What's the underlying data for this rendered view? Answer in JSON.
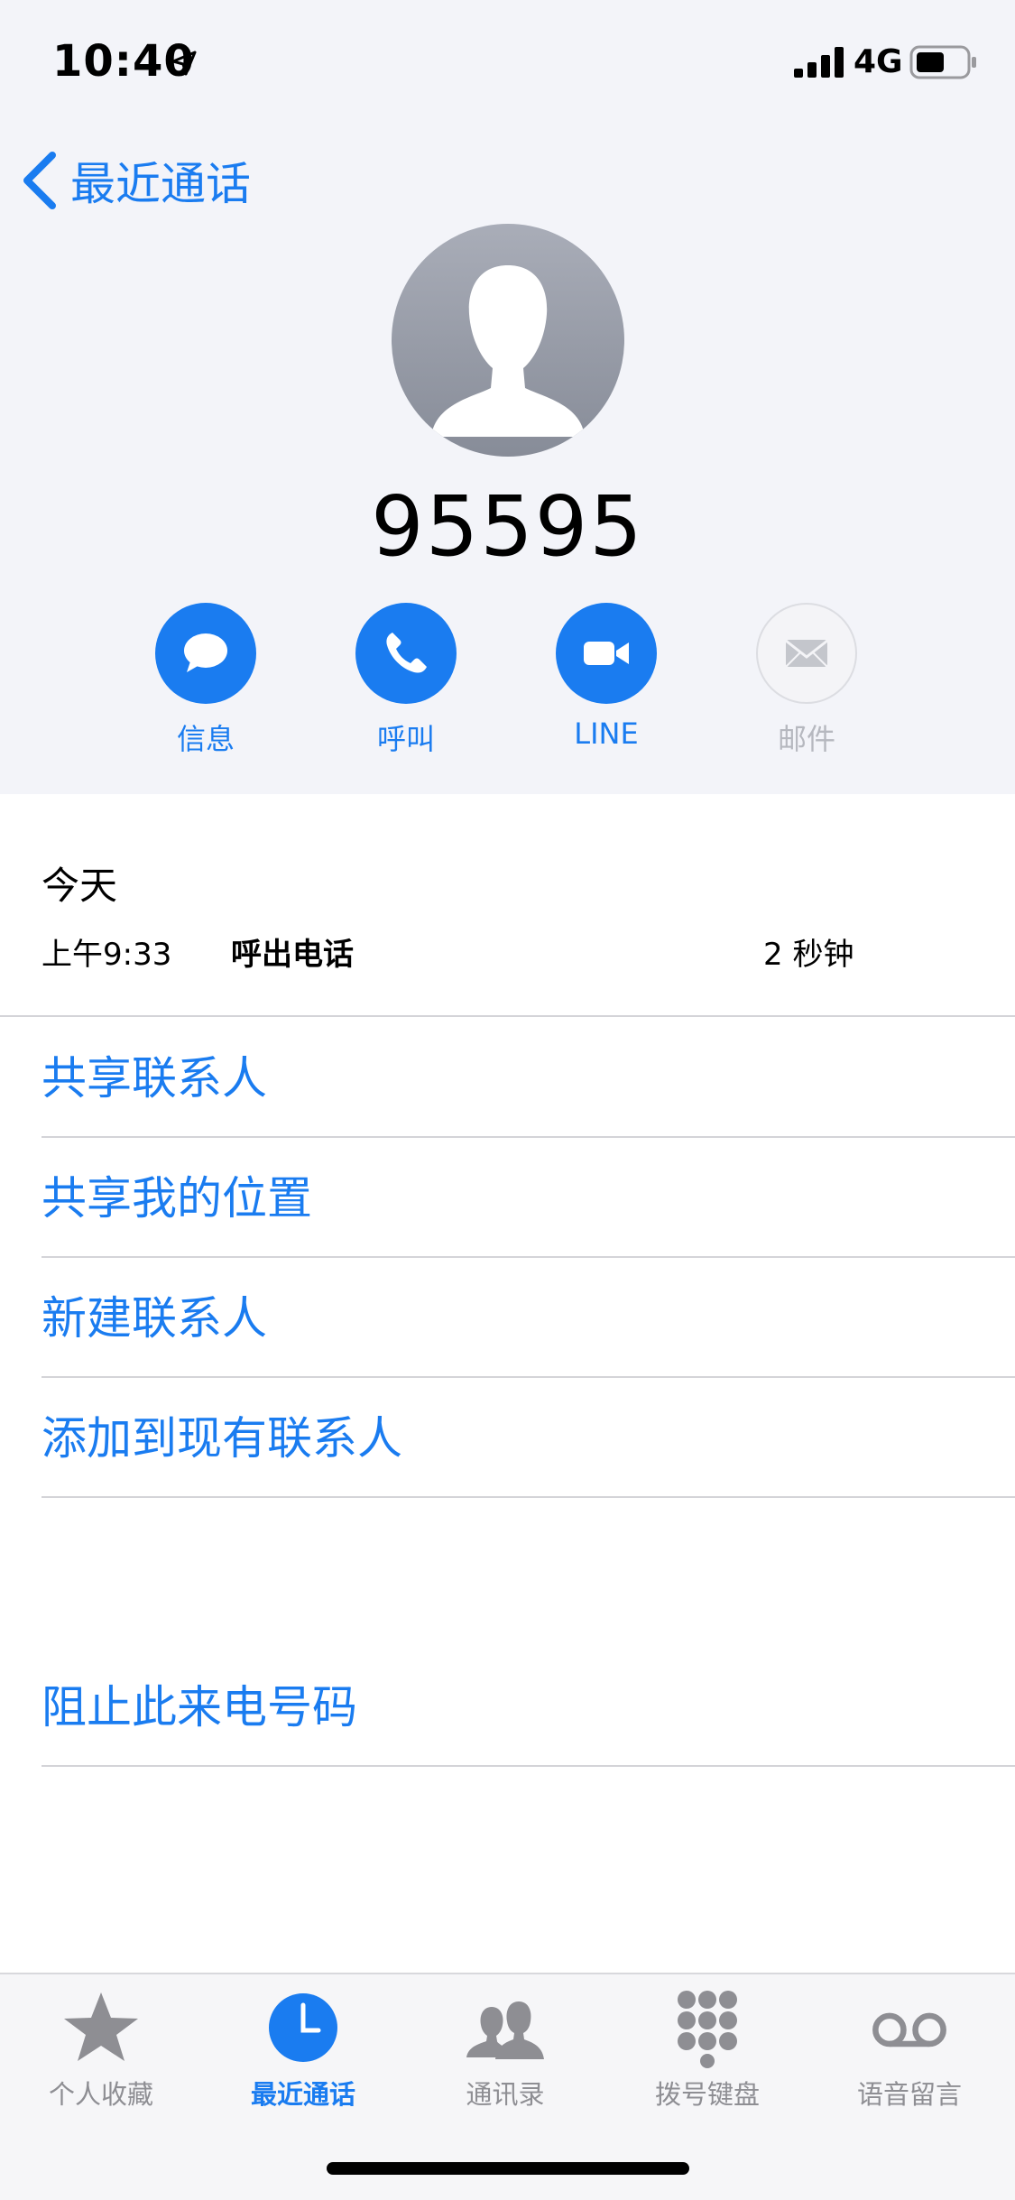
{
  "status_bar": {
    "time": "10:40",
    "network": "4G"
  },
  "nav": {
    "back_label": "最近通话"
  },
  "contact": {
    "number": "95595"
  },
  "actions": [
    {
      "label": "信息",
      "icon": "message-icon",
      "enabled": true
    },
    {
      "label": "呼叫",
      "icon": "phone-icon",
      "enabled": true
    },
    {
      "label": "LINE",
      "icon": "video-icon",
      "enabled": true
    },
    {
      "label": "邮件",
      "icon": "mail-icon",
      "enabled": false
    }
  ],
  "history": {
    "section_label": "今天",
    "calls": [
      {
        "time": "上午9:33",
        "type": "呼出电话",
        "duration": "2 秒钟"
      }
    ]
  },
  "menu": {
    "share_contact": "共享联系人",
    "share_location": "共享我的位置",
    "new_contact": "新建联系人",
    "add_existing": "添加到现有联系人",
    "block": "阻止此来电号码"
  },
  "tabs": [
    {
      "label": "个人收藏",
      "icon": "star-icon",
      "active": false
    },
    {
      "label": "最近通话",
      "icon": "clock-icon",
      "active": true
    },
    {
      "label": "通讯录",
      "icon": "contacts-icon",
      "active": false
    },
    {
      "label": "拨号键盘",
      "icon": "keypad-icon",
      "active": false
    },
    {
      "label": "语音留言",
      "icon": "voicemail-icon",
      "active": false
    }
  ],
  "colors": {
    "accent": "#1a7cf0",
    "inactive": "#8e8e93",
    "background_top": "#f3f4f9"
  }
}
